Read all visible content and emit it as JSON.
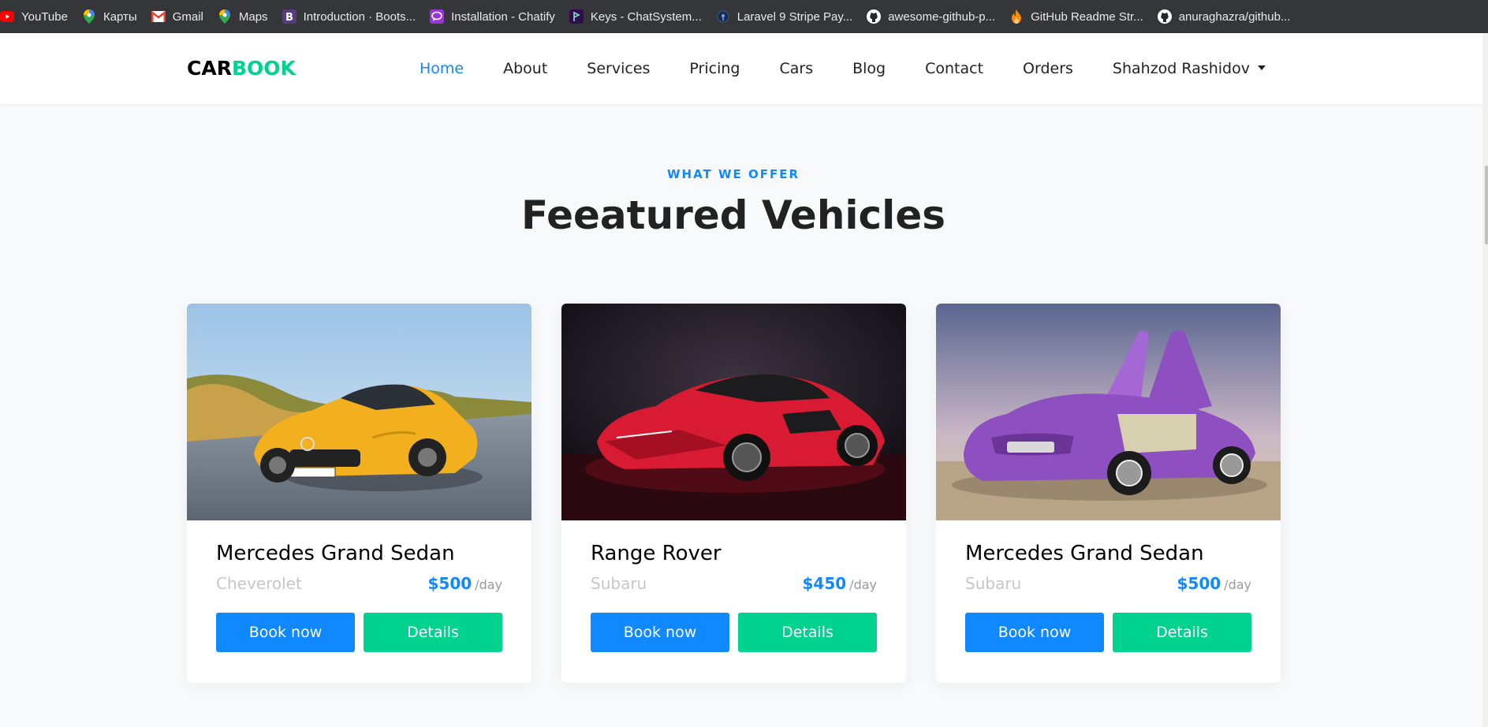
{
  "bookmarks": [
    {
      "label": "YouTube",
      "icon": "youtube-icon"
    },
    {
      "label": "Карты",
      "icon": "maps-pin-icon"
    },
    {
      "label": "Gmail",
      "icon": "gmail-icon"
    },
    {
      "label": "Maps",
      "icon": "maps-pin-icon"
    },
    {
      "label": "Introduction · Boots...",
      "icon": "bootstrap-icon"
    },
    {
      "label": "Installation - Chatify",
      "icon": "chatify-icon"
    },
    {
      "label": "Keys - ChatSystem...",
      "icon": "pusher-icon"
    },
    {
      "label": "Laravel 9 Stripe Pay...",
      "icon": "globe-icon"
    },
    {
      "label": "awesome-github-p...",
      "icon": "github-icon"
    },
    {
      "label": "GitHub Readme Str...",
      "icon": "fire-icon"
    },
    {
      "label": "anuraghazra/github...",
      "icon": "github-icon"
    }
  ],
  "navbar": {
    "brand_part1": "CAR",
    "brand_part2": "BOOK",
    "links": [
      "Home",
      "About",
      "Services",
      "Pricing",
      "Cars",
      "Blog",
      "Contact",
      "Orders",
      "Shahzod Rashidov"
    ],
    "active": "Home"
  },
  "section": {
    "subheading": "WHAT WE OFFER",
    "heading": "Feeatured Vehicles"
  },
  "cars": [
    {
      "title": "Mercedes Grand Sedan",
      "brand": "Cheverolet",
      "price": "$500",
      "per": "/day",
      "book": "Book now",
      "details": "Details",
      "color": "#f2b01e"
    },
    {
      "title": "Range Rover",
      "brand": "Subaru",
      "price": "$450",
      "per": "/day",
      "book": "Book now",
      "details": "Details",
      "color": "#d81b32"
    },
    {
      "title": "Mercedes Grand Sedan",
      "brand": "Subaru",
      "price": "$500",
      "per": "/day",
      "book": "Book now",
      "details": "Details",
      "color": "#8e4fc0"
    }
  ],
  "colors": {
    "primary": "#1089ff",
    "secondary": "#01d28e",
    "text": "#222222"
  }
}
